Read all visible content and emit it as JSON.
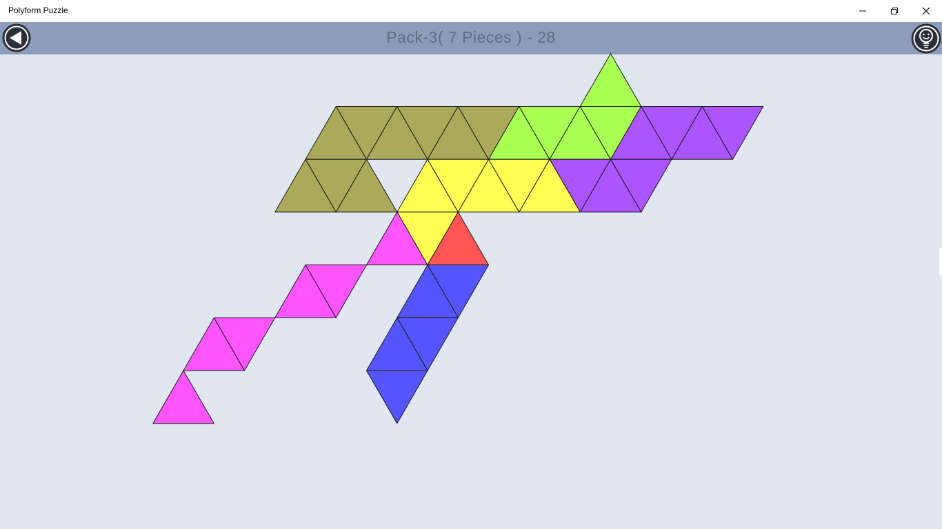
{
  "window": {
    "app_title": "Polyform Puzzle",
    "minimize_icon": "minimize-icon",
    "restore_icon": "restore-icon",
    "close_icon": "close-icon"
  },
  "header": {
    "title": "Pack-3( 7 Pieces ) - 28",
    "back_icon": "back-arrow-icon",
    "hint_icon": "lightbulb-hint-icon",
    "background": "#8d9cbb"
  },
  "board": {
    "background": "#e1e7f0",
    "pieces": [
      {
        "name": "piece-olive",
        "color": "#aaaa5a",
        "cells": [
          [
            0,
            1,
            "up"
          ],
          [
            0,
            1,
            "down"
          ],
          [
            0,
            2,
            "up"
          ],
          [
            0,
            2,
            "down"
          ],
          [
            1,
            1,
            "up"
          ],
          [
            1,
            1,
            "down"
          ],
          [
            0,
            3,
            "up"
          ],
          [
            0,
            3,
            "down"
          ],
          [
            1,
            2,
            "up"
          ]
        ]
      },
      {
        "name": "piece-green",
        "color": "#aaff55",
        "cells": [
          [
            0,
            4,
            "up"
          ],
          [
            0,
            4,
            "down"
          ],
          [
            0,
            5,
            "up"
          ],
          [
            0,
            5,
            "down"
          ],
          [
            -1,
            5,
            "up"
          ]
        ]
      },
      {
        "name": "piece-purple",
        "color": "#aa55ff",
        "cells": [
          [
            0,
            6,
            "up"
          ],
          [
            0,
            6,
            "down"
          ],
          [
            0,
            7,
            "up"
          ],
          [
            0,
            7,
            "down"
          ],
          [
            1,
            5,
            "down"
          ],
          [
            1,
            6,
            "up"
          ],
          [
            1,
            6,
            "down"
          ]
        ]
      },
      {
        "name": "piece-yellow",
        "color": "#ffff55",
        "cells": [
          [
            1,
            3,
            "up"
          ],
          [
            1,
            3,
            "down"
          ],
          [
            1,
            4,
            "up"
          ],
          [
            1,
            4,
            "down"
          ],
          [
            1,
            5,
            "up"
          ],
          [
            2,
            3,
            "down"
          ]
        ]
      },
      {
        "name": "piece-red",
        "color": "#ff5555",
        "cells": [
          [
            2,
            4,
            "up"
          ]
        ]
      },
      {
        "name": "piece-magenta",
        "color": "#ff55ff",
        "cells": [
          [
            2,
            3,
            "up"
          ],
          [
            3,
            2,
            "up"
          ],
          [
            3,
            2,
            "down"
          ],
          [
            4,
            1,
            "up"
          ],
          [
            4,
            1,
            "down"
          ],
          [
            5,
            1,
            "up"
          ]
        ]
      },
      {
        "name": "piece-blue",
        "color": "#5555ff",
        "cells": [
          [
            3,
            4,
            "down"
          ],
          [
            3,
            4,
            "up"
          ],
          [
            4,
            4,
            "down"
          ],
          [
            4,
            4,
            "up"
          ],
          [
            5,
            4,
            "down"
          ]
        ]
      }
    ]
  }
}
